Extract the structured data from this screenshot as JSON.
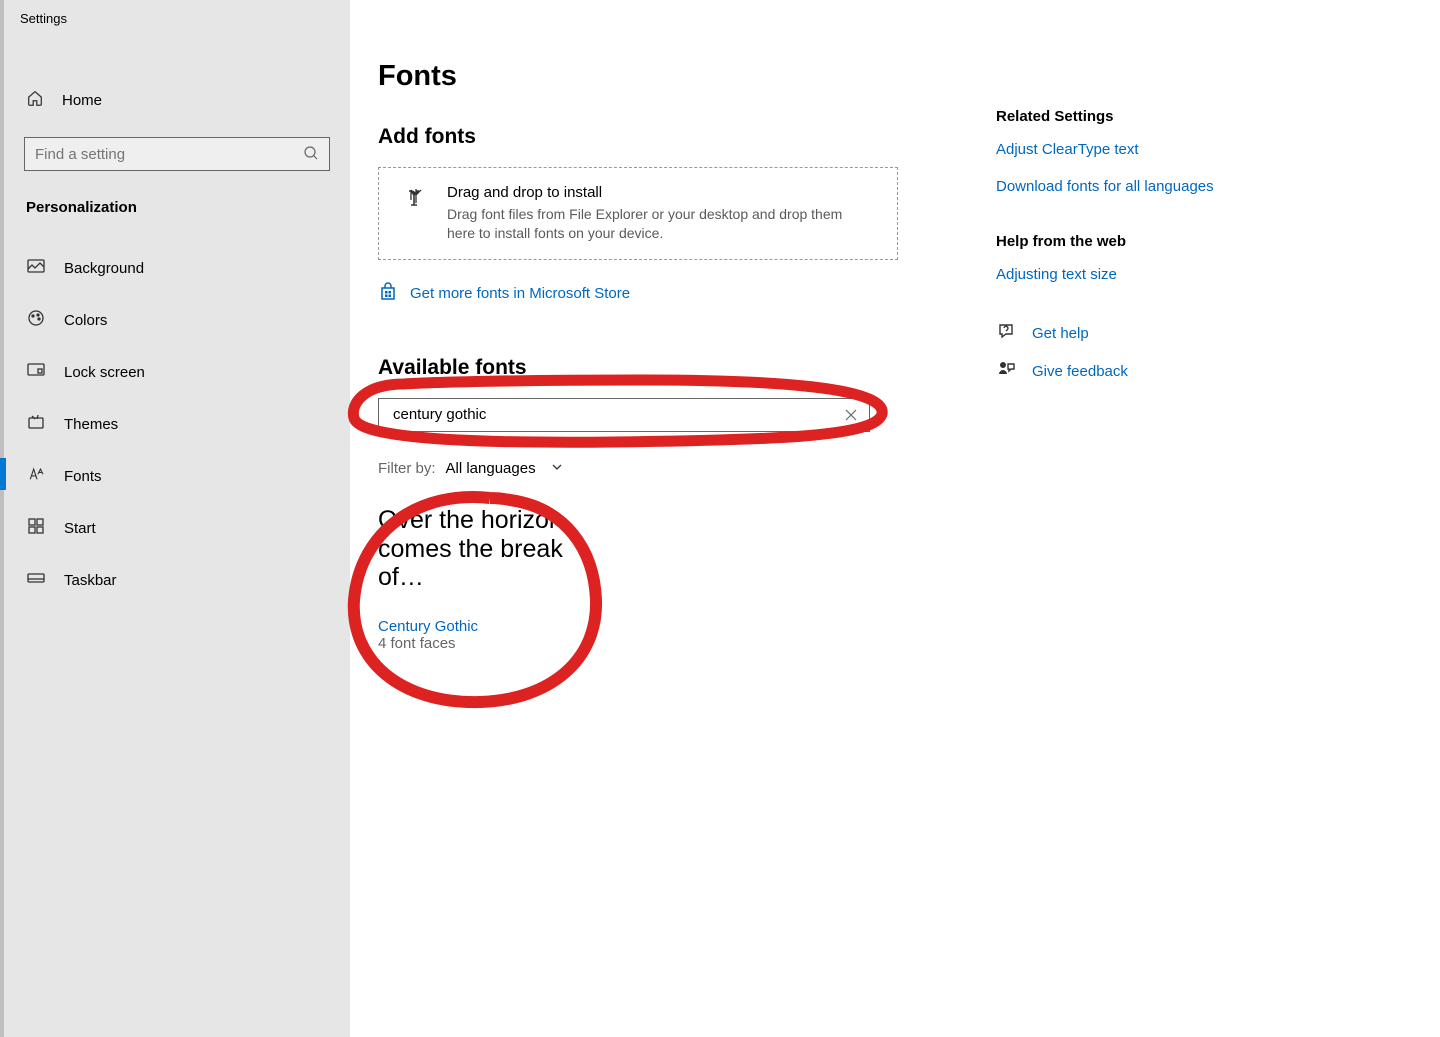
{
  "window": {
    "title": "Settings"
  },
  "sidebar": {
    "home": "Home",
    "search_placeholder": "Find a setting",
    "section": "Personalization",
    "items": [
      {
        "label": "Background"
      },
      {
        "label": "Colors"
      },
      {
        "label": "Lock screen"
      },
      {
        "label": "Themes"
      },
      {
        "label": "Fonts",
        "active": true
      },
      {
        "label": "Start"
      },
      {
        "label": "Taskbar"
      }
    ]
  },
  "page": {
    "title": "Fonts",
    "add_fonts_heading": "Add fonts",
    "drop_title": "Drag and drop to install",
    "drop_sub": "Drag font files from File Explorer or your desktop and drop them here to install fonts on your device.",
    "store_link": "Get more fonts in Microsoft Store",
    "available_heading": "Available fonts",
    "filter_search_value": "century gothic",
    "filter_label": "Filter by:",
    "filter_value": "All languages"
  },
  "font_result": {
    "preview": "Over the horizon comes the break of…",
    "name": "Century Gothic",
    "faces": "4 font faces"
  },
  "right": {
    "related_heading": "Related Settings",
    "related_links": [
      "Adjust ClearType text",
      "Download fonts for all languages"
    ],
    "help_heading": "Help from the web",
    "help_links": [
      "Adjusting text size"
    ],
    "get_help": "Get help",
    "give_feedback": "Give feedback"
  }
}
